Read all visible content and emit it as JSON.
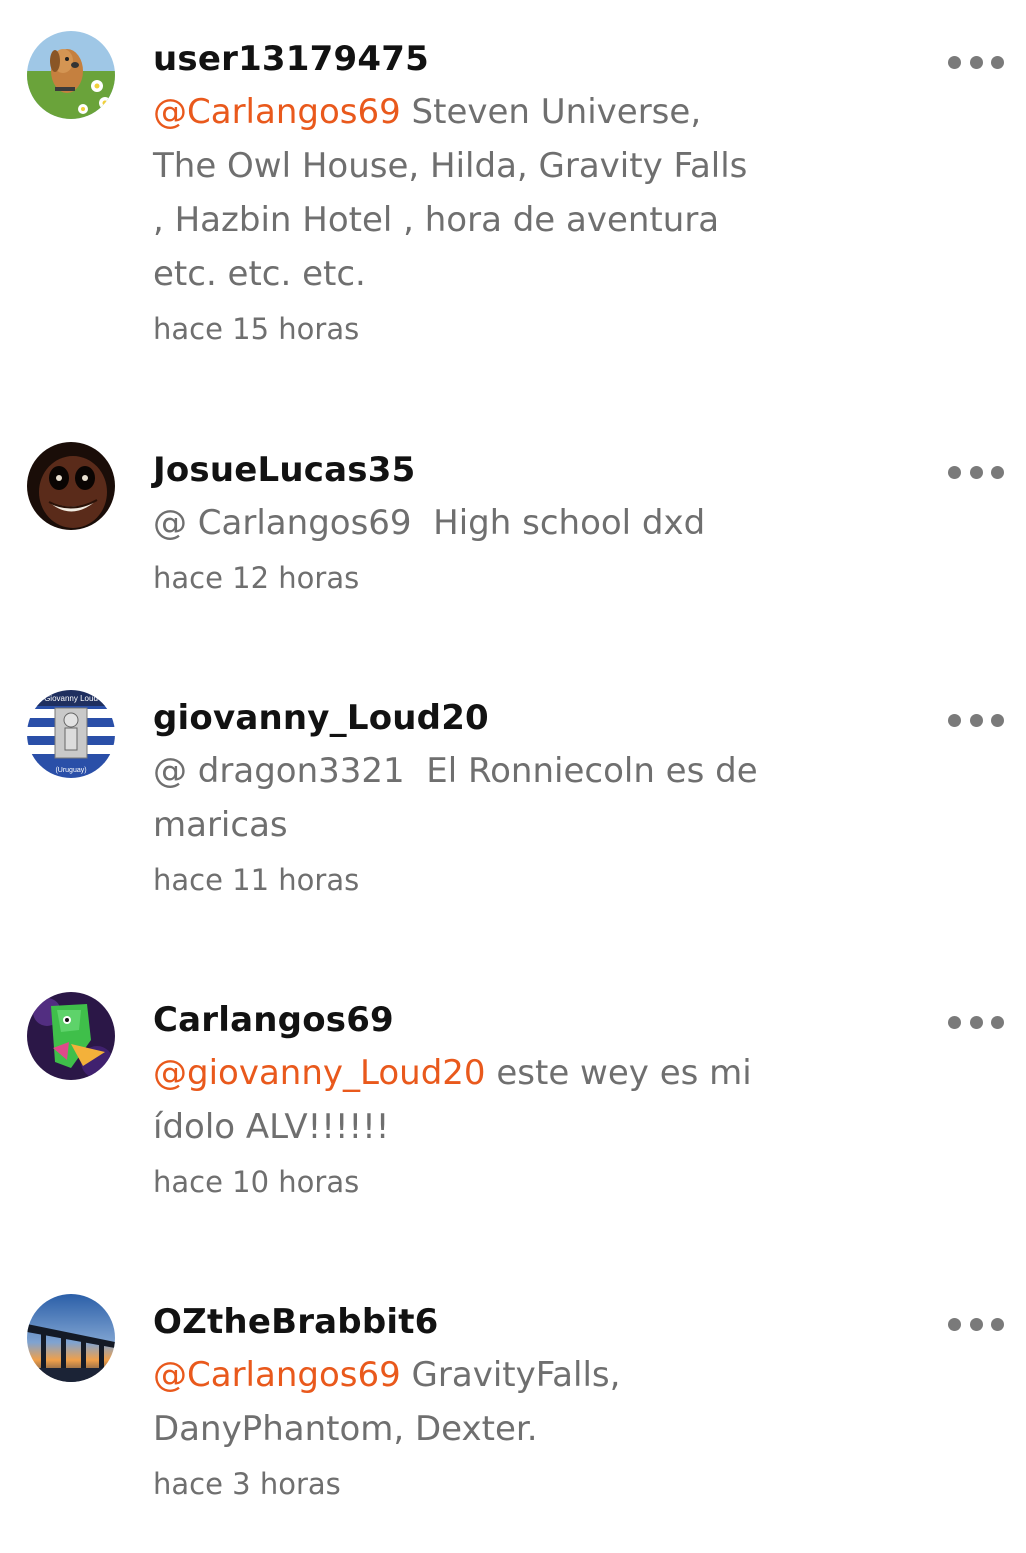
{
  "comments": [
    {
      "username": "user13179475",
      "mention": "@Carlangos69",
      "text": " Steven Universe,\nThe Owl House, Hilda, Gravity Falls\n, Hazbin Hotel , hora de aventura\netc. etc. etc.",
      "timestamp": "hace 15 horas"
    },
    {
      "username": "JosueLucas35",
      "mention": "",
      "text": "@ Carlangos69  High school dxd",
      "timestamp": "hace 12 horas"
    },
    {
      "username": "giovanny_Loud20",
      "mention": "",
      "text": "@ dragon3321  El Ronniecoln es de\nmaricas",
      "timestamp": "hace 11 horas",
      "avatar_text_top": "Giovanny Loud",
      "avatar_text_bottom": "(Uruguay)"
    },
    {
      "username": "Carlangos69",
      "mention": "@giovanny_Loud20",
      "text": " este wey es mi\nídolo ALV!!!!!!",
      "timestamp": "hace 10 horas"
    },
    {
      "username": "OZtheBrabbit6",
      "mention": "@Carlangos69",
      "text": " GravityFalls,\nDanyPhantom, Dexter.",
      "timestamp": "hace 3 horas"
    }
  ],
  "icons": {
    "more": "more-options-icon",
    "avatar_1": "dog-avatar",
    "avatar_2": "creepy-face-avatar",
    "avatar_3": "uruguay-flag-avatar",
    "avatar_4": "cartoon-character-avatar",
    "avatar_5": "bridge-sunset-avatar"
  },
  "colors": {
    "mention": "#e9591c",
    "username": "#121212",
    "body": "#6f6f6f"
  }
}
